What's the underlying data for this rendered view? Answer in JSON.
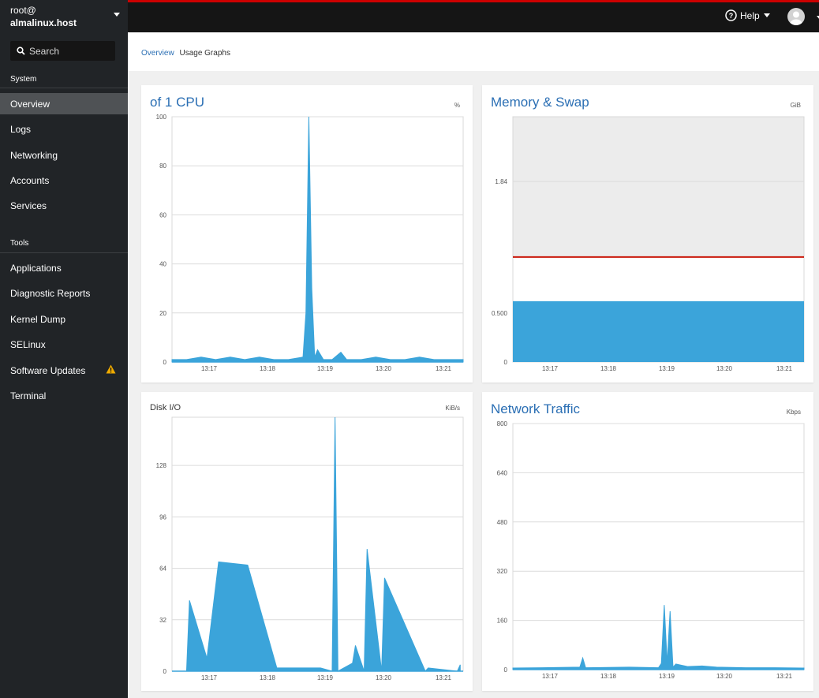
{
  "host": {
    "user": "root@",
    "name": "almalinux.host"
  },
  "search": {
    "placeholder": "Search"
  },
  "nav": {
    "system_title": "System",
    "system_items": [
      "Overview",
      "Logs",
      "Networking",
      "Accounts",
      "Services"
    ],
    "tools_title": "Tools",
    "tools_items": [
      "Applications",
      "Diagnostic Reports",
      "Kernel Dump",
      "SELinux",
      "Software Updates",
      "Terminal"
    ],
    "active": "Overview",
    "warning_item": "Software Updates"
  },
  "topbar": {
    "help_label": "Help"
  },
  "breadcrumb": {
    "root": "Overview",
    "current": "Usage Graphs"
  },
  "colors": {
    "accent": "#2b6fb4",
    "series": "#3ba4da",
    "limit": "#c9190b",
    "warning": "#f0ab00"
  },
  "chart_data": [
    {
      "type": "area",
      "title": "of 1 CPU",
      "unit": "%",
      "ylim": [
        0,
        100
      ],
      "yticks": [
        "100",
        "80",
        "60",
        "40",
        "20",
        "0"
      ],
      "xticks": [
        "13:17",
        "13:18",
        "13:19",
        "13:20",
        "13:21"
      ],
      "series": [
        {
          "x": [
            0,
            5,
            10,
            15,
            20,
            25,
            30,
            35,
            40,
            45,
            46,
            47,
            48,
            49,
            50,
            52,
            55,
            58,
            60,
            65,
            70,
            75,
            80,
            85,
            90,
            95,
            100
          ],
          "values": [
            1,
            1,
            2,
            1,
            2,
            1,
            2,
            1,
            1,
            2,
            20,
            100,
            30,
            2,
            5,
            1,
            1,
            4,
            1,
            1,
            2,
            1,
            1,
            2,
            1,
            1,
            1
          ]
        }
      ]
    },
    {
      "type": "area",
      "title": "Memory & Swap",
      "unit": "GiB",
      "ylim": [
        0,
        2.5
      ],
      "yticks": [
        "1.84",
        "0.500",
        "0"
      ],
      "xticks": [
        "13:17",
        "13:18",
        "13:19",
        "13:20",
        "13:21"
      ],
      "series": [
        {
          "name": "memory",
          "x": [
            0,
            100
          ],
          "values": [
            0.62,
            0.62
          ]
        },
        {
          "name": "limit",
          "x": [
            0,
            100
          ],
          "values": [
            1.07,
            1.07
          ]
        }
      ]
    },
    {
      "type": "area",
      "title": "Disk I/O",
      "unit": "KiB/s",
      "ylim": [
        0,
        158
      ],
      "yticks": [
        "128",
        "96",
        "64",
        "32",
        "0"
      ],
      "xticks": [
        "13:17",
        "13:18",
        "13:19",
        "13:20",
        "13:21"
      ],
      "series": [
        {
          "x": [
            5,
            6,
            12,
            16,
            26,
            36,
            51,
            55,
            56,
            57,
            62,
            63,
            66,
            67,
            72,
            73,
            87,
            88,
            98,
            99
          ],
          "values": [
            0,
            44,
            8,
            68,
            66,
            2,
            2,
            0,
            158,
            0,
            5,
            16,
            0,
            76,
            0,
            58,
            0,
            2,
            0,
            4
          ]
        }
      ]
    },
    {
      "type": "area",
      "title": "Network Traffic",
      "unit": "Kbps",
      "ylim": [
        0,
        800
      ],
      "yticks": [
        "800",
        "640",
        "480",
        "320",
        "160",
        "0"
      ],
      "xticks": [
        "13:17",
        "13:18",
        "13:19",
        "13:20",
        "13:21"
      ],
      "series": [
        {
          "x": [
            0,
            10,
            23,
            24,
            25,
            40,
            50,
            51,
            52,
            53,
            54,
            55,
            56,
            60,
            65,
            70,
            80,
            90,
            100
          ],
          "values": [
            5,
            6,
            8,
            38,
            6,
            8,
            6,
            20,
            210,
            20,
            190,
            8,
            18,
            10,
            12,
            8,
            6,
            6,
            5
          ]
        }
      ]
    }
  ]
}
